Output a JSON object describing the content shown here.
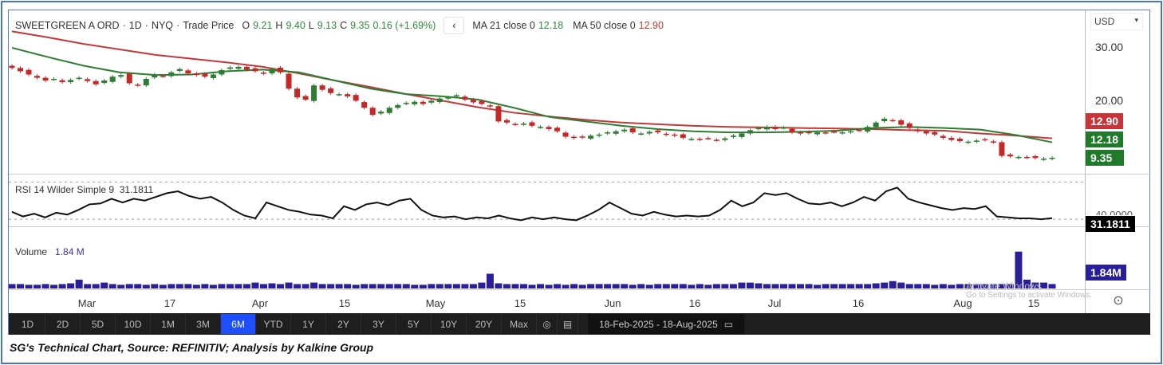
{
  "header": {
    "instrument": "SWEETGREEN A ORD",
    "interval": "1D",
    "exchange": "NYQ",
    "price_type": "Trade Price",
    "open_label": "O",
    "open": "9.21",
    "high_label": "H",
    "high": "9.40",
    "low_label": "L",
    "low": "9.13",
    "close_label": "C",
    "close": "9.35",
    "change": "0.16 (+1.69%)",
    "ma21_label": "MA 21 close 0",
    "ma21_value": "12.18",
    "ma50_label": "MA 50 close 0",
    "ma50_value": "12.90"
  },
  "axis": {
    "currency": "USD",
    "ticks": [
      "30.00",
      "20.00"
    ],
    "tag_ma50": "12.90",
    "tag_ma21": "12.18",
    "tag_close": "9.35",
    "rsi_tick": "40.0000",
    "rsi_tag": "31.1811",
    "vol_tag": "1.84M"
  },
  "rsi": {
    "label": "RSI 14 Wilder Simple 9",
    "value": "31.1811"
  },
  "volume": {
    "label": "Volume",
    "value": "1.84 M"
  },
  "x_labels": [
    "Mar",
    "17",
    "Apr",
    "15",
    "May",
    "15",
    "Jun",
    "16",
    "Jul",
    "16",
    "Aug",
    "15"
  ],
  "toolbar": {
    "ranges": [
      "1D",
      "2D",
      "5D",
      "10D",
      "1M",
      "3M",
      "6M",
      "YTD",
      "1Y",
      "2Y",
      "3Y",
      "5Y",
      "10Y",
      "20Y",
      "Max"
    ],
    "active": "6M",
    "date_range": "18-Feb-2025 - 18-Aug-2025"
  },
  "watermark": {
    "line1": "Activate Windows",
    "line2": "Go to Settings to activate Windows."
  },
  "caption": "SG's Technical Chart, Source: REFINITIV; Analysis by Kalkine Group",
  "colors": {
    "up": "#2e7d32",
    "down": "#c62828",
    "ma21": "#2e7d32",
    "ma50": "#c0393b",
    "volume": "#2a1f9a",
    "rsi": "#111111"
  },
  "chart_data": {
    "type": "candlestick",
    "price_range": [
      9,
      33
    ],
    "closes": [
      25.8,
      25.2,
      24.6,
      24.0,
      23.5,
      23.8,
      23.2,
      23.6,
      24.0,
      23.4,
      22.8,
      23.5,
      24.2,
      24.5,
      23.0,
      22.6,
      23.8,
      24.6,
      24.3,
      25.0,
      25.6,
      24.8,
      24.5,
      24.2,
      24.6,
      25.4,
      25.9,
      26.0,
      25.5,
      25.2,
      24.8,
      25.6,
      25.0,
      22.0,
      20.4,
      20.0,
      22.6,
      21.8,
      21.2,
      21.0,
      20.6,
      19.8,
      18.5,
      17.2,
      17.8,
      18.5,
      19.0,
      19.4,
      19.6,
      19.2,
      19.8,
      20.2,
      20.4,
      20.8,
      20.0,
      19.5,
      19.2,
      18.8,
      16.0,
      15.8,
      15.5,
      15.6,
      15.2,
      15.0,
      14.6,
      14.2,
      13.2,
      13.0,
      13.1,
      13.4,
      13.6,
      14.0,
      14.2,
      14.5,
      14.0,
      13.8,
      14.1,
      14.0,
      13.6,
      13.4,
      13.0,
      12.8,
      12.7,
      12.9,
      12.6,
      12.9,
      13.4,
      13.8,
      14.4,
      14.8,
      15.0,
      14.6,
      14.9,
      14.0,
      13.8,
      13.9,
      14.0,
      13.9,
      14.1,
      14.0,
      14.2,
      14.4,
      15.0,
      15.8,
      16.5,
      16.2,
      15.4,
      14.8,
      14.2,
      13.8,
      13.6,
      13.0,
      12.6,
      12.4,
      12.3,
      12.5,
      12.6,
      12.2,
      9.7,
      9.6,
      9.5,
      9.4,
      9.3,
      9.19,
      9.35
    ],
    "ma21": [
      29.5,
      27.8,
      26.2,
      25.0,
      24.5,
      24.6,
      25.2,
      25.5,
      25.0,
      23.5,
      22.0,
      21.0,
      20.6,
      20.0,
      18.5,
      16.8,
      16.0,
      15.2,
      14.6,
      14.2,
      14.0,
      14.0,
      14.1,
      14.3,
      14.8,
      15.0,
      14.8,
      14.5,
      13.5,
      12.18
    ],
    "ma50": [
      32.5,
      31.4,
      30.2,
      29.2,
      28.2,
      27.5,
      26.8,
      26.0,
      24.8,
      23.5,
      22.3,
      21.0,
      19.8,
      18.6,
      17.6,
      16.9,
      16.3,
      15.8,
      15.5,
      15.2,
      15.0,
      14.9,
      14.8,
      14.7,
      14.6,
      14.4,
      14.3,
      13.8,
      13.4,
      12.9
    ],
    "rsi_values": [
      38,
      33,
      36,
      32,
      37,
      35,
      40,
      46,
      47,
      52,
      48,
      52,
      50,
      54,
      58,
      60,
      55,
      52,
      54,
      48,
      40,
      34,
      31,
      48,
      44,
      40,
      38,
      35,
      34,
      31,
      44,
      40,
      46,
      48,
      45,
      50,
      52,
      40,
      34,
      32,
      33,
      30,
      32,
      31,
      34,
      31,
      29,
      32,
      30,
      32,
      30,
      29,
      34,
      40,
      48,
      42,
      36,
      34,
      38,
      35,
      33,
      34,
      33,
      34,
      40,
      50,
      44,
      48,
      58,
      56,
      58,
      52,
      47,
      46,
      48,
      44,
      48,
      54,
      50,
      60,
      64,
      52,
      48,
      45,
      42,
      40,
      42,
      41,
      44,
      33,
      32,
      31,
      31,
      30,
      31.18
    ],
    "rsi_range": [
      25,
      72
    ],
    "rsi_levels": [
      70,
      30
    ],
    "volumes": [
      3,
      3,
      2.5,
      2.5,
      3,
      2.5,
      3,
      3.5,
      6,
      3,
      3,
      4,
      3,
      2.5,
      3,
      3,
      2.5,
      3,
      2.5,
      3,
      3,
      3,
      2.5,
      3,
      2.5,
      3,
      3,
      3,
      3,
      4,
      3,
      3.5,
      3,
      4,
      3,
      3,
      4,
      3,
      3,
      3,
      3,
      2.5,
      3,
      3,
      3,
      3,
      3,
      3,
      2.5,
      2.5,
      3,
      3,
      3,
      3,
      3,
      3,
      4,
      10,
      3.5,
      3,
      3,
      3,
      2.5,
      3,
      2.5,
      3,
      2.5,
      3,
      2.5,
      3,
      3,
      3,
      3,
      3,
      2.5,
      3,
      2.5,
      3,
      3,
      3,
      3,
      2.5,
      3,
      2.5,
      3,
      3,
      3,
      4,
      4,
      3.5,
      3,
      3,
      3,
      3,
      3,
      3,
      2.5,
      3,
      3,
      3,
      3,
      3,
      3,
      3.5,
      4,
      5,
      4,
      3,
      3,
      3,
      2.5,
      3,
      2.5,
      3,
      3,
      3,
      3,
      3,
      3,
      3,
      25,
      6,
      4,
      4,
      3,
      1.84
    ],
    "volume_max": 27
  }
}
